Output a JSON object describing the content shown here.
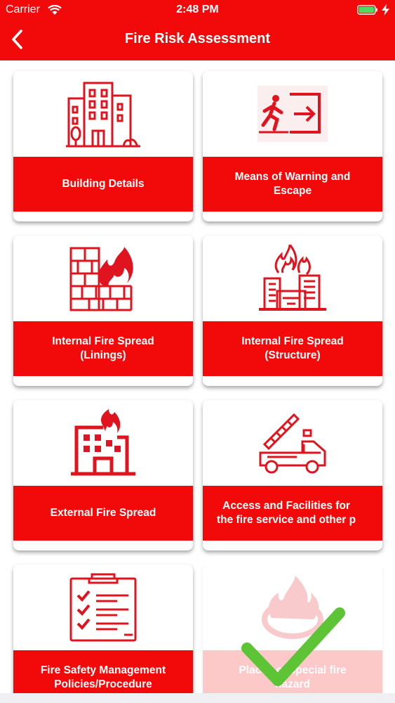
{
  "status_bar": {
    "carrier": "Carrier",
    "time": "2:48 PM",
    "battery_color": "#4cd964"
  },
  "header": {
    "title": "Fire Risk Assessment",
    "background": "#f20a0a",
    "back_icon": "chevron-left-icon"
  },
  "cards": [
    {
      "label": "Building Details",
      "icon": "building-icon",
      "state": "normal"
    },
    {
      "label": "Means of Warning and\nEscape",
      "icon": "exit-sign-icon",
      "state": "normal"
    },
    {
      "label": "Internal Fire Spread\n(Linings)",
      "icon": "wall-fire-icon",
      "state": "normal"
    },
    {
      "label": "Internal Fire Spread\n(Structure)",
      "icon": "burning-buildings-icon",
      "state": "normal"
    },
    {
      "label": "External Fire Spread",
      "icon": "burning-building-icon",
      "state": "normal"
    },
    {
      "label": "Access and Facilities for\nthe fire service and other p",
      "icon": "fire-truck-icon",
      "state": "normal"
    },
    {
      "label": "Fire Safety Management\nPolicies/Procedure",
      "icon": "clipboard-checklist-icon",
      "state": "normal"
    },
    {
      "label": "Places of special fire\nhazard",
      "icon": "fire-ring-icon",
      "state": "completed"
    }
  ],
  "overlay": {
    "icon": "checkmark-icon",
    "color": "#5cc435"
  }
}
